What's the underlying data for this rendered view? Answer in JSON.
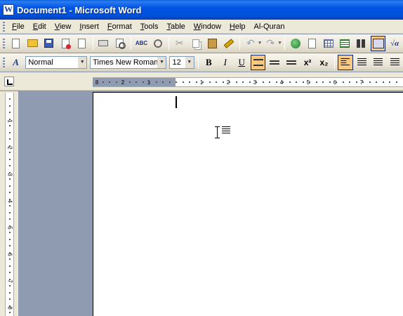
{
  "window": {
    "title": "Document1 - Microsoft Word"
  },
  "menu": [
    {
      "label": "File",
      "acc": "F",
      "rest": "ile"
    },
    {
      "label": "Edit",
      "acc": "E",
      "rest": "dit"
    },
    {
      "label": "View",
      "acc": "V",
      "rest": "iew"
    },
    {
      "label": "Insert",
      "acc": "I",
      "rest": "nsert"
    },
    {
      "label": "Format",
      "acc": "F",
      "rest": "ormat"
    },
    {
      "label": "Tools",
      "acc": "T",
      "rest": "ools"
    },
    {
      "label": "Table",
      "acc": "T",
      "rest": "able"
    },
    {
      "label": "Window",
      "acc": "W",
      "rest": "indow"
    },
    {
      "label": "Help",
      "acc": "H",
      "rest": "elp"
    },
    {
      "label": "Al-Quran",
      "acc": "",
      "rest": "Al-Quran"
    }
  ],
  "formatting": {
    "style_value": "Normal",
    "font_value": "Times New Roman",
    "size_value": "12",
    "bold_label": "B",
    "italic_label": "I",
    "underline_label": "U",
    "superscript_label": "x²",
    "subscript_label": "x₂"
  },
  "standard": {
    "spelling_label": "ABC",
    "equation_label": "√α"
  },
  "ruler": {
    "h_labels": [
      "3",
      "2",
      "1",
      "1",
      "2",
      "3",
      "4",
      "5",
      "6",
      "7"
    ],
    "v_labels": [
      "1",
      "2",
      "3",
      "4",
      "5",
      "6",
      "7",
      "8"
    ]
  },
  "colors": {
    "titlebar": "#0054e3",
    "active_button": "#fdc981",
    "workspace": "#8f9bb0",
    "chrome": "#ece9d8"
  }
}
